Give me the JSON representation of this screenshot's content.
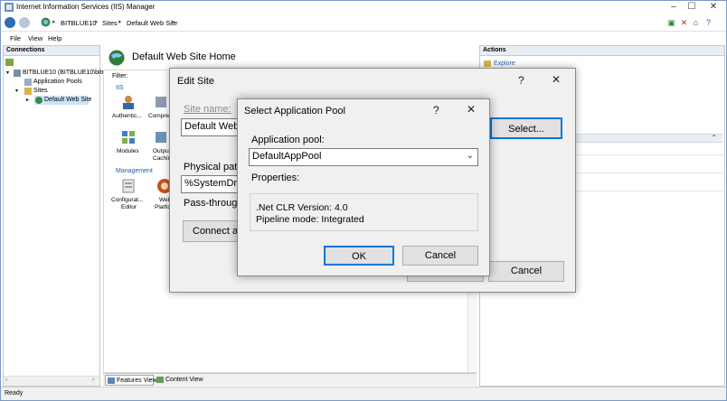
{
  "window": {
    "title": "Internet Information Services (IIS) Manager",
    "controls": [
      "–",
      "☐",
      "✕"
    ]
  },
  "address_bar": {
    "breadcrumbs": [
      "BITBLUE10",
      "Sites",
      "Default Web Site"
    ]
  },
  "menu": {
    "items": [
      "File",
      "View",
      "Help"
    ]
  },
  "connections": {
    "header": "Connections",
    "tree": {
      "server": "BITBLUE10 (BITBLUE10\\bitma",
      "app_pools": "Application Pools",
      "sites": "Sites",
      "site": "Default Web Site"
    }
  },
  "center": {
    "title": "Default Web Site Home",
    "filter_label": "Filter:",
    "section_iis": "IIS",
    "section_management": "Management",
    "features": {
      "authentication": "Authentic...",
      "compression": "Compres",
      "modules": "Modules",
      "output_caching_1": "Outpu",
      "output_caching_2": "Cachin",
      "config_editor_1": "Configurat...",
      "config_editor_2": "Editor",
      "web_platform_1": "Web",
      "web_platform_2": "Platfor"
    },
    "tabs": {
      "features_view": "Features View",
      "content_view": "Content View"
    }
  },
  "actions": {
    "header": "Actions",
    "explore": "Explore"
  },
  "status": {
    "text": "Ready"
  },
  "edit_site": {
    "title": "Edit Site",
    "help": "?",
    "close": "✕",
    "site_name_label": "Site name:",
    "site_name_value": "Default Web",
    "select_button": "Select...",
    "physical_path_label": "Physical path",
    "physical_path_value": "%SystemDrive",
    "pass_through_label": "Pass-through",
    "connect_as_button": "Connect as",
    "cancel_button": "Cancel"
  },
  "select_app_pool": {
    "title": "Select Application Pool",
    "help": "?",
    "close": "✕",
    "pool_label": "Application pool:",
    "pool_value": "DefaultAppPool",
    "properties_label": "Properties:",
    "clr_version": ".Net CLR Version: 4.0",
    "pipeline_mode": "Pipeline mode: Integrated",
    "ok_button": "OK",
    "cancel_button": "Cancel"
  },
  "colors": {
    "accent": "#0078d7",
    "link": "#1f5fa8",
    "dialog_bg": "#f0f0f0"
  }
}
